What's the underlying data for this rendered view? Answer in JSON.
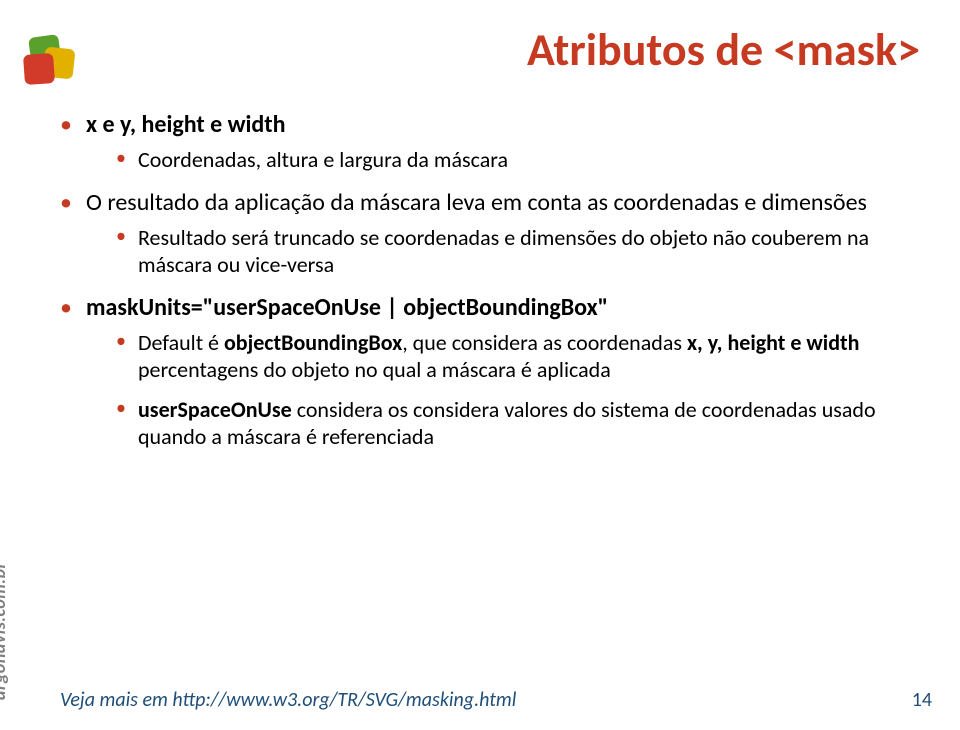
{
  "title": "Atributos de <mask>",
  "bullets": {
    "b1_label": "x e y, height e width",
    "b1_sub1": "Coordenadas, altura e largura da máscara",
    "b2_text": "O resultado da aplicação da máscara leva em conta as coordenadas e dimensões",
    "b2_sub1": "Resultado será truncado se coordenadas e dimensões do objeto não couberem na máscara ou vice-versa",
    "b3_label": "maskUnits=\"userSpaceOnUse | objectBoundingBox\"",
    "b3_sub1_pre": "Default é ",
    "b3_sub1_bold1": "objectBoundingBox",
    "b3_sub1_mid1": ", que considera as coordenadas ",
    "b3_sub1_bold2": "x, y, height e width",
    "b3_sub1_tail": " percentagens do objeto no qual a máscara é aplicada",
    "b3_sub2_bold": "userSpaceOnUse",
    "b3_sub2_tail": " considera os considera valores do sistema de coordenadas usado quando a máscara é referenciada"
  },
  "footer": {
    "link_label": "Veja mais em http://www.w3.org/TR/SVG/masking.html",
    "page_number": "14",
    "brand": "argonavis.com.br"
  }
}
